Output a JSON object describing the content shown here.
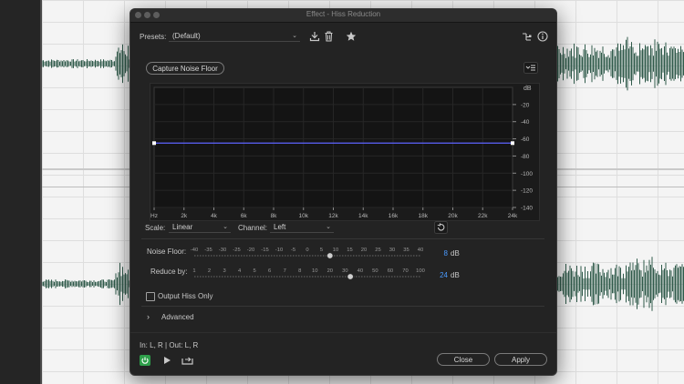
{
  "dialog": {
    "title": "Effect - Hiss Reduction",
    "presets_label": "Presets:",
    "preset_value": "(Default)",
    "capture_button": "Capture Noise Floor"
  },
  "graph": {
    "unit_label": "dB",
    "db_ticks": [
      "-20",
      "-40",
      "-60",
      "-80",
      "-100",
      "-120",
      "-140"
    ],
    "freq_ticks": [
      "Hz",
      "2k",
      "4k",
      "6k",
      "8k",
      "10k",
      "12k",
      "14k",
      "16k",
      "18k",
      "20k",
      "22k",
      "24k"
    ],
    "line_db": -65,
    "line_color": "#5d63ff"
  },
  "controls": {
    "scale_label": "Scale:",
    "scale_value": "Linear",
    "channel_label": "Channel:",
    "channel_value": "Left"
  },
  "noise_floor": {
    "label": "Noise Floor:",
    "ticks": [
      "-40",
      "-35",
      "-30",
      "-25",
      "-20",
      "-15",
      "-10",
      "-5",
      "0",
      "5",
      "10",
      "15",
      "20",
      "25",
      "30",
      "35",
      "40"
    ],
    "value": "8",
    "unit": "dB",
    "fraction": 0.6
  },
  "reduce_by": {
    "label": "Reduce by:",
    "ticks": [
      "1",
      "2",
      "3",
      "4",
      "5",
      "6",
      "7",
      "8",
      "10",
      "20",
      "30",
      "40",
      "50",
      "60",
      "70",
      "100"
    ],
    "value": "24",
    "unit": "dB",
    "fraction": 0.69
  },
  "output_hiss_only": {
    "label": "Output Hiss Only",
    "checked": false
  },
  "advanced": {
    "label": "Advanced",
    "expanded": false
  },
  "footer": {
    "io_text": "In: L, R | Out: L, R",
    "close_button": "Close",
    "apply_button": "Apply"
  },
  "colors": {
    "accent_blue": "#4a9bff",
    "power_green": "#2e9f4a"
  }
}
